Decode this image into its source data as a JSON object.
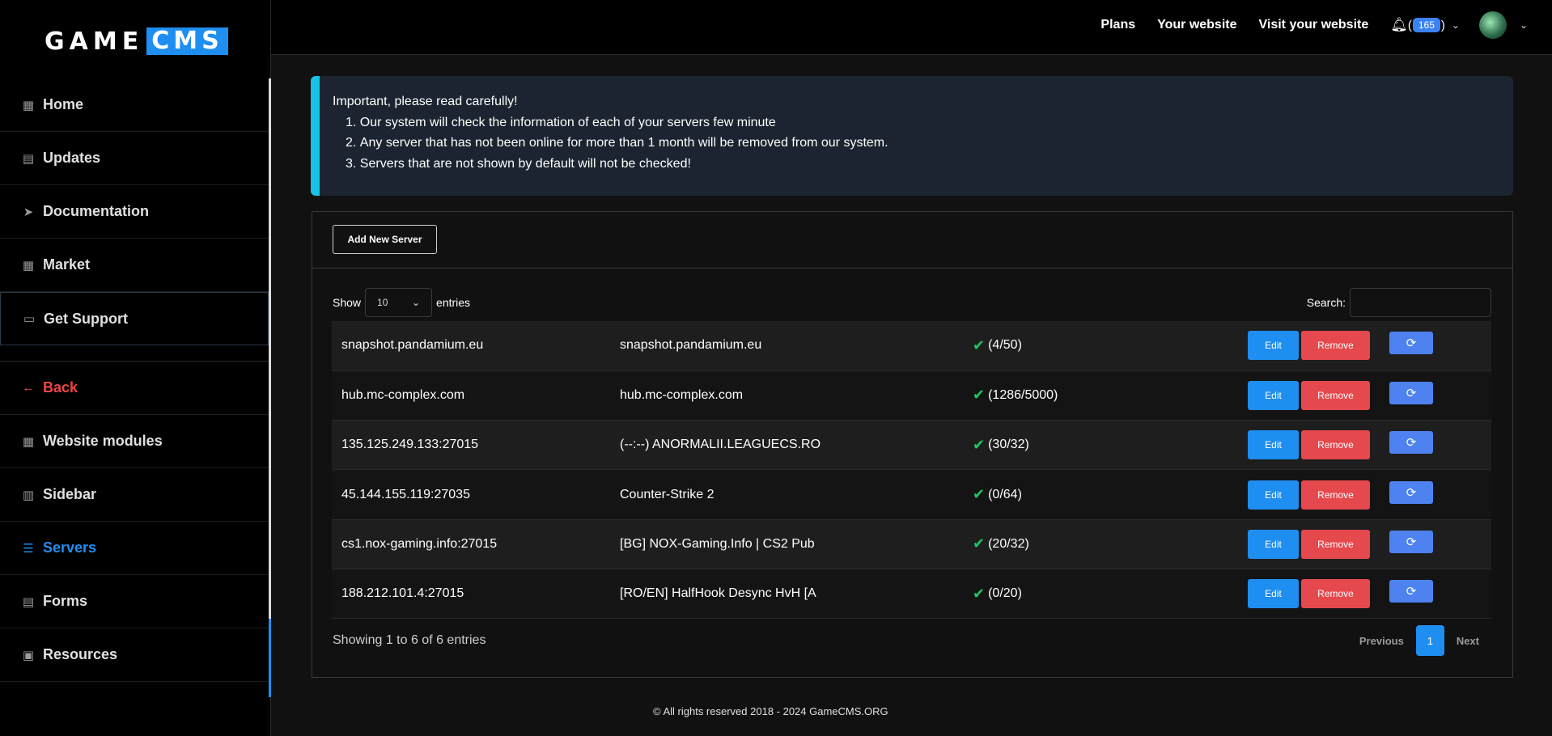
{
  "logo": {
    "part1": "GAME",
    "part2": "CMS"
  },
  "sidebar": {
    "items": [
      {
        "label": "Home",
        "icon": "grid-icon",
        "glyph": "▦"
      },
      {
        "label": "Updates",
        "icon": "newspaper-icon",
        "glyph": "▤"
      },
      {
        "label": "Documentation",
        "icon": "paper-plane-icon",
        "glyph": "➤"
      },
      {
        "label": "Market",
        "icon": "store-icon",
        "glyph": "▦"
      },
      {
        "label": "Get Support",
        "icon": "ticket-icon",
        "glyph": "▭"
      },
      {
        "label": "Back",
        "icon": "arrow-left-icon",
        "glyph": "←"
      },
      {
        "label": "Website modules",
        "icon": "modules-icon",
        "glyph": "▦"
      },
      {
        "label": "Sidebar",
        "icon": "sidebar-icon",
        "glyph": "▥"
      },
      {
        "label": "Servers",
        "icon": "server-icon",
        "glyph": "☰"
      },
      {
        "label": "Forms",
        "icon": "form-icon",
        "glyph": "▤"
      },
      {
        "label": "Resources",
        "icon": "archive-icon",
        "glyph": "▣"
      }
    ]
  },
  "topbar": {
    "links": [
      "Plans",
      "Your website",
      "Visit your website"
    ],
    "notifications_count": "165",
    "bell_paren_open": "(",
    "bell_paren_close": ")"
  },
  "alert": {
    "heading": "Important, please read carefully!",
    "items": [
      "Our system will check the information of each of your servers few minute",
      "Any server that has not been online for more than 1 month will be removed from our system.",
      "Servers that are not shown by default will not be checked!"
    ]
  },
  "toolbar": {
    "add_label": "Add New Server"
  },
  "table_controls": {
    "show_label": "Show",
    "entries_value": "10",
    "entries_label": "entries",
    "search_label": "Search:"
  },
  "servers": [
    {
      "address": "snapshot.pandamium.eu",
      "name": "snapshot.pandamium.eu",
      "players": "(4/50)"
    },
    {
      "address": "hub.mc-complex.com",
      "name": "hub.mc-complex.com",
      "players": "(1286/5000)"
    },
    {
      "address": "135.125.249.133:27015",
      "name": "(--:--) ANORMALII.LEAGUECS.RO",
      "players": "(30/32)"
    },
    {
      "address": "45.144.155.119:27035",
      "name": "Counter-Strike 2",
      "players": "(0/64)"
    },
    {
      "address": "cs1.nox-gaming.info:27015",
      "name": "[BG] NOX-Gaming.Info | CS2 Pub",
      "players": "(20/32)"
    },
    {
      "address": "188.212.101.4:27015",
      "name": "[RO/EN] HalfHook Desync HvH [A",
      "players": "(0/20)"
    }
  ],
  "row_actions": {
    "edit": "Edit",
    "remove": "Remove"
  },
  "table_footer": {
    "info": "Showing 1 to 6 of 6 entries",
    "prev": "Previous",
    "page": "1",
    "next": "Next"
  },
  "footer": {
    "text": "© All rights reserved 2018 - 2024 GameCMS.ORG"
  },
  "colors": {
    "accent": "#1f8ef1",
    "danger": "#e5484d",
    "success": "#22c55e",
    "alert_bar": "#14c4e6"
  }
}
